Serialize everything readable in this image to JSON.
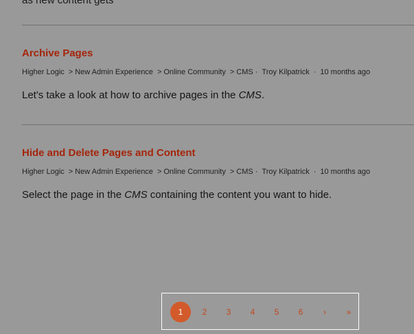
{
  "previous_result": {
    "snippet_tail": "as new content gets"
  },
  "results": [
    {
      "title": "Archive Pages",
      "breadcrumbs": [
        "Higher Logic",
        "New Admin Experience",
        "Online Community",
        "CMS"
      ],
      "author": "Troy Kilpatrick",
      "time": "10 months ago",
      "snippet_before": "Let's take a look at how to archive pages in the ",
      "snippet_em": "CMS",
      "snippet_after": "."
    },
    {
      "title": "Hide and Delete Pages and Content",
      "breadcrumbs": [
        "Higher Logic",
        "New Admin Experience",
        "Online Community",
        "CMS"
      ],
      "author": "Troy Kilpatrick",
      "time": "10 months ago",
      "snippet_before": "Select the page in the ",
      "snippet_em": "CMS",
      "snippet_after": " containing the content you want to hide."
    }
  ],
  "breadcrumb_separator": ">",
  "meta_dot": "·",
  "pagination": {
    "current": "1",
    "pages": [
      "1",
      "2",
      "3",
      "4",
      "5",
      "6"
    ],
    "next_label": "›",
    "last_label": "»"
  },
  "colors": {
    "background": "#999999",
    "title": "#a5260c",
    "pagination_accent": "#d35a2a"
  }
}
